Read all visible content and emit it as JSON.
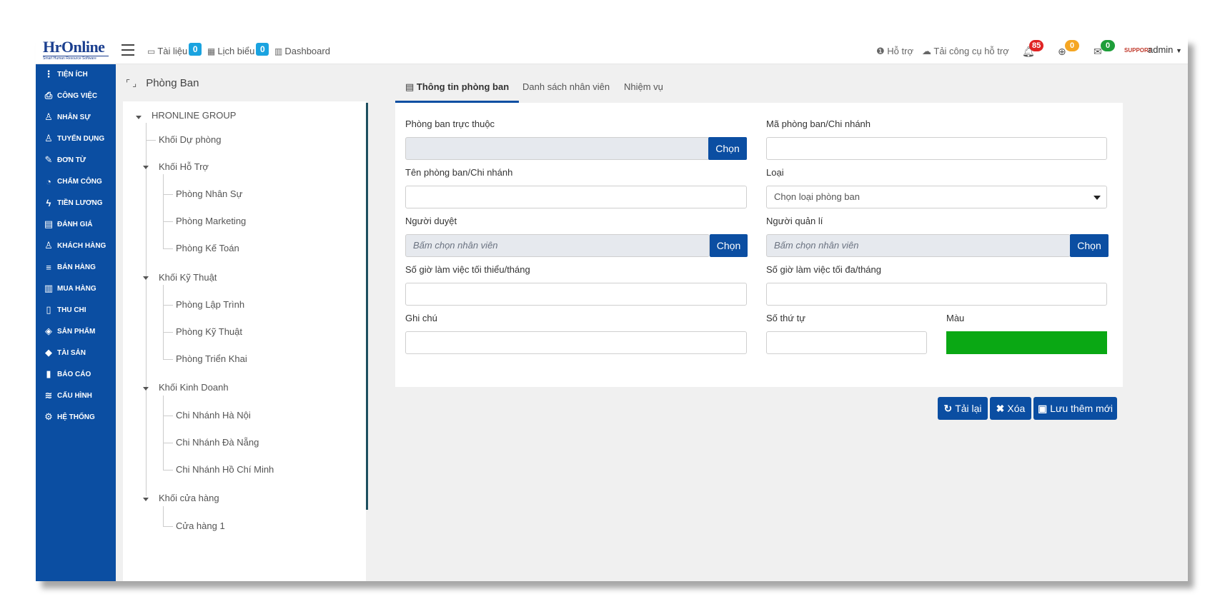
{
  "app": {
    "logo_text": "HrOnline",
    "logo_sub": "Smart Human Resource Software"
  },
  "header": {
    "documents_label": "Tài liệu",
    "documents_count": "0",
    "schedule_label": "Lịch biểu",
    "schedule_count": "0",
    "dashboard_label": "Dashboard",
    "support_label": "Hỗ trợ",
    "download_tool_label": "Tải công cụ hỗ trợ",
    "notifications": [
      {
        "icon": "bell-icon",
        "count": "85",
        "color": "#e02424"
      },
      {
        "icon": "globe-icon",
        "count": "0",
        "color": "#f5a623"
      },
      {
        "icon": "mail-icon",
        "count": "0",
        "color": "#1e9e3a"
      }
    ],
    "avatar_text": "SUPPORT",
    "user_label": "admin"
  },
  "sidebar": {
    "items": [
      {
        "icon": "more-vertical-icon",
        "label": "TIỆN ÍCH"
      },
      {
        "icon": "inbox-icon",
        "label": "CÔNG VIỆC"
      },
      {
        "icon": "user-icon",
        "label": "NHÂN SỰ"
      },
      {
        "icon": "user-plus-icon",
        "label": "TUYỂN DỤNG"
      },
      {
        "icon": "edit-icon",
        "label": "ĐƠN TỪ"
      },
      {
        "icon": "gauge-icon",
        "label": "CHẤM CÔNG"
      },
      {
        "icon": "bolt-icon",
        "label": "TIỀN LƯƠNG"
      },
      {
        "icon": "book-icon",
        "label": "ĐÁNH GIÁ"
      },
      {
        "icon": "customer-icon",
        "label": "KHÁCH HÀNG"
      },
      {
        "icon": "list-icon",
        "label": "BÁN HÀNG"
      },
      {
        "icon": "columns-icon",
        "label": "MUA HÀNG"
      },
      {
        "icon": "file-icon",
        "label": "THU CHI"
      },
      {
        "icon": "tag-icon",
        "label": "SẢN PHẨM"
      },
      {
        "icon": "diamond-icon",
        "label": "TÀI SẢN"
      },
      {
        "icon": "bar-chart-icon",
        "label": "BÁO CÁO"
      },
      {
        "icon": "layers-icon",
        "label": "CẤU HÌNH"
      },
      {
        "icon": "gear-icon",
        "label": "HỆ THỐNG"
      }
    ]
  },
  "tree": {
    "title": "Phòng Ban",
    "root": "HRONLINE GROUP",
    "nodes": [
      "Khối Dự phòng",
      "Khối Hỗ Trợ",
      "Phòng Nhân Sự",
      "Phòng Marketing",
      "Phòng Kế Toán",
      "Khối Kỹ Thuật",
      "Phòng Lập Trình",
      "Phòng Kỹ Thuật",
      "Phòng Triển Khai",
      "Khối Kinh Doanh",
      "Chi Nhánh Hà Nội",
      "Chi Nhánh Đà Nẵng",
      "Chi Nhánh Hồ Chí Minh",
      "Khối cửa hàng",
      "Cửa hàng 1"
    ]
  },
  "tabs": {
    "info": "Thông tin phòng ban",
    "employees": "Danh sách nhân viên",
    "tasks": "Nhiệm vụ"
  },
  "form": {
    "parent_label": "Phòng ban trực thuộc",
    "parent_value": "",
    "choose_label": "Chọn",
    "code_label": "Mã phòng ban/Chi nhánh",
    "code_value": "",
    "name_label": "Tên phòng ban/Chi nhánh",
    "name_value": "",
    "type_label": "Loại",
    "type_placeholder": "Chọn loại phòng ban",
    "approver_label": "Người duyệt",
    "approver_placeholder": "Bấm chọn nhân viên",
    "manager_label": "Người quản lí",
    "manager_placeholder": "Bấm chọn nhân viên",
    "min_hours_label": "Số giờ làm việc tối thiểu/tháng",
    "min_hours_value": "",
    "max_hours_label": "Số giờ làm việc tối đa/tháng",
    "max_hours_value": "",
    "note_label": "Ghi chú",
    "note_value": "",
    "order_label": "Số thứ tự",
    "order_value": "",
    "color_label": "Màu",
    "color_value": "#0aa814"
  },
  "actions": {
    "reload": "Tải lại",
    "delete": "Xóa",
    "save_new": "Lưu thêm mới"
  }
}
